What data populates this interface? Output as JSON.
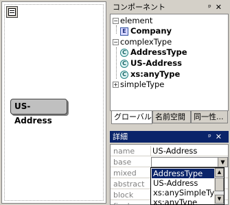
{
  "design": {
    "element_label": "US-Address"
  },
  "components": {
    "title": "コンポーネント",
    "pin": "ᵖ",
    "close": "✕",
    "tree": [
      {
        "label": "element",
        "expander": "−",
        "bold": false
      },
      {
        "label": "Company",
        "icon": "E",
        "bold": true
      },
      {
        "label": "complexType",
        "expander": "−",
        "bold": false
      },
      {
        "label": "AddressType",
        "icon": "C",
        "bold": true
      },
      {
        "label": "US-Address",
        "icon": "C",
        "bold": true
      },
      {
        "label": "xs:anyType",
        "icon": "C",
        "bold": true
      },
      {
        "label": "simpleType",
        "expander": "+",
        "bold": false
      }
    ],
    "tabs": [
      "グローバル",
      "名前空間",
      "同一性..."
    ]
  },
  "details": {
    "title": "詳細",
    "pin": "ᵖ",
    "close": "✕",
    "properties": [
      {
        "name": "name",
        "value": "US-Address"
      },
      {
        "name": "base",
        "value": ""
      },
      {
        "name": "mixed",
        "value": ""
      },
      {
        "name": "abstract",
        "value": ""
      },
      {
        "name": "block",
        "value": ""
      },
      {
        "name": "final",
        "value": ""
      }
    ],
    "base_dropdown": [
      "AddressType",
      "US-Address",
      "xs:anySimpleType",
      "xs:anyType"
    ]
  }
}
